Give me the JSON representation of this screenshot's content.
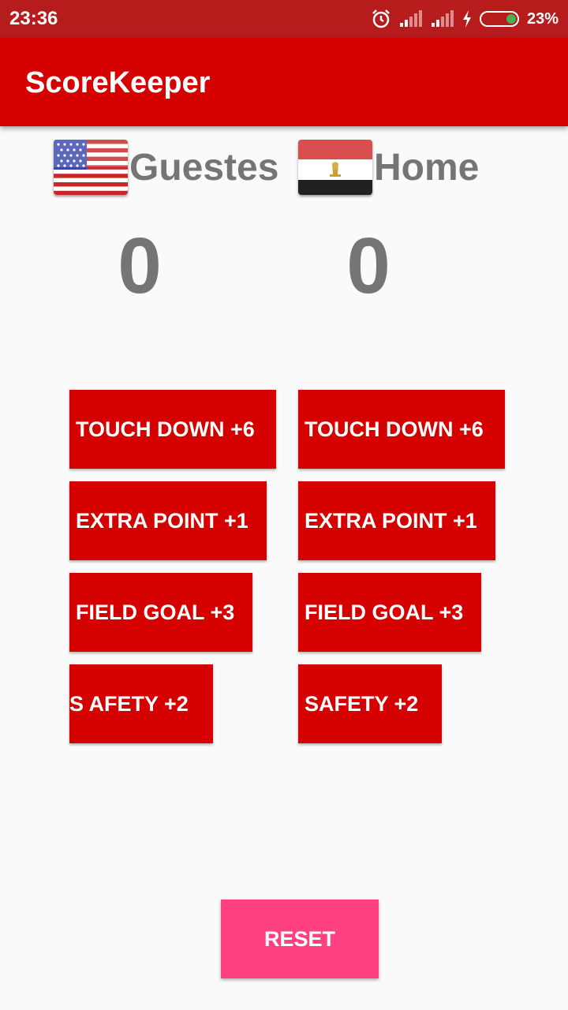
{
  "status_bar": {
    "time": "23:36",
    "battery_percent": "23%",
    "icons": [
      "alarm-icon",
      "signal-icon",
      "signal-icon",
      "charging-icon",
      "battery-icon"
    ]
  },
  "app_bar": {
    "title": "ScoreKeeper",
    "color": "#d50000"
  },
  "teams": {
    "guests": {
      "name": "Guestes",
      "flag": "usa-flag-icon",
      "score": "0",
      "buttons": {
        "touchdown": "TOUCH DOWN +6",
        "extra_point": "EXTRA POINT +1",
        "field_goal": "FIELD GOAL +3",
        "safety": "S AFETY +2"
      }
    },
    "home": {
      "name": "Home",
      "flag": "egypt-flag-icon",
      "score": "0",
      "buttons": {
        "touchdown": "TOUCH DOWN +6",
        "extra_point": "EXTRA POINT +1",
        "field_goal": "FIELD GOAL +3",
        "safety": "SAFETY +2"
      }
    }
  },
  "reset_label": "RESET",
  "colors": {
    "primary": "#d50000",
    "status_bar": "#b71c1c",
    "accent": "#ff4081",
    "score_text": "#757575"
  }
}
